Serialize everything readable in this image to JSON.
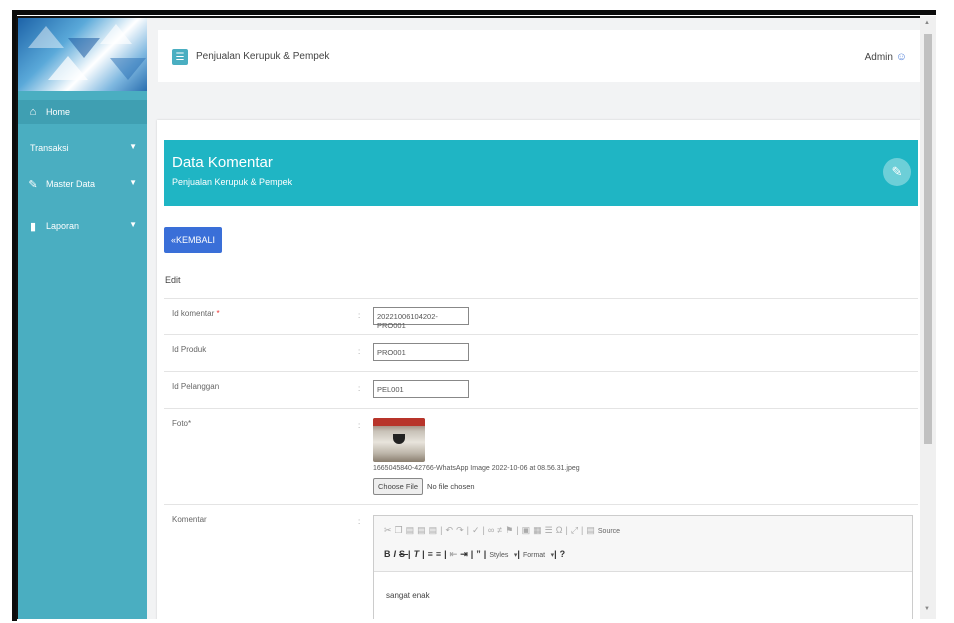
{
  "app": {
    "title": "Penjualan Kerupuk & Pempek",
    "user": "Admin"
  },
  "sidebar": {
    "items": [
      {
        "label": "Home",
        "icon": "home-icon"
      },
      {
        "label": "Transaksi",
        "icon": ""
      },
      {
        "label": "Master Data",
        "icon": "edit-icon"
      },
      {
        "label": "Laporan",
        "icon": "document-icon"
      }
    ]
  },
  "card": {
    "title": "Data Komentar",
    "subtitle": "Penjualan Kerupuk & Pempek",
    "back_label": "KEMBALI",
    "section": "Edit"
  },
  "form": {
    "id_komentar": {
      "label": "Id komentar",
      "required": "*",
      "value": "20221006104202-PRO001"
    },
    "id_produk": {
      "label": "Id Produk",
      "value": "PRO001"
    },
    "id_pelanggan": {
      "label": "Id Pelanggan",
      "value": "PEL001"
    },
    "foto": {
      "label": "Foto",
      "required": "*",
      "filename": "1665045840-42766-WhatsApp Image 2022-10-06 at 08.56.31.jpeg",
      "button": "Choose File",
      "status": "No file chosen"
    },
    "komentar": {
      "label": "Komentar",
      "value": "sangat enak",
      "source_label": "Source",
      "styles_label": "Styles",
      "format_label": "Format"
    }
  },
  "colors": {
    "sidebar": "#4aaec1",
    "header_band": "#1fb5c4",
    "primary_button": "#3a6fd8"
  }
}
